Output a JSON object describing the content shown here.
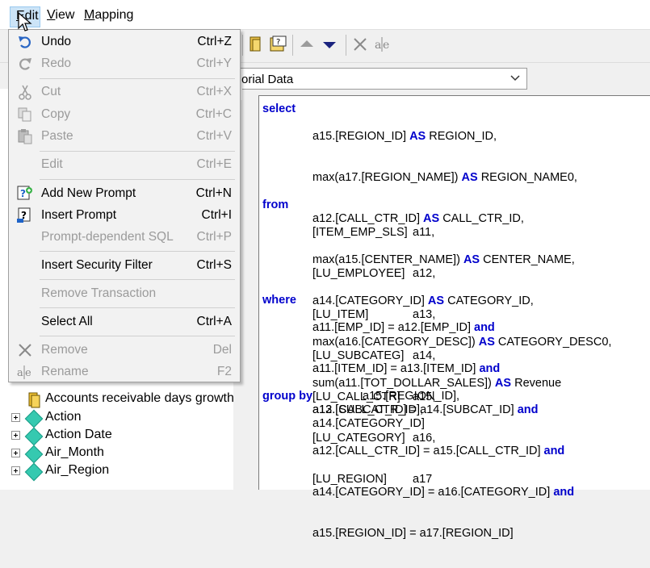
{
  "menubar": {
    "items": [
      {
        "label": "Edit",
        "mnemonic": "E",
        "rest": "dit"
      },
      {
        "label": "View",
        "mnemonic": "V",
        "rest": "iew"
      },
      {
        "label": "Mapping",
        "mnemonic": "M",
        "rest": "apping"
      }
    ]
  },
  "toolbar": {
    "icons": [
      "data-source-icon",
      "prompt-icon",
      "move-up-icon",
      "move-down-icon",
      "delete-icon",
      "rename-icon"
    ]
  },
  "combo": {
    "value": "orial Data"
  },
  "edit_menu": {
    "items": [
      {
        "label": "Undo",
        "shortcut": "Ctrl+Z",
        "icon": "undo-icon",
        "enabled": true
      },
      {
        "label": "Redo",
        "shortcut": "Ctrl+Y",
        "icon": "redo-icon",
        "enabled": false
      },
      {
        "label": "Cut",
        "shortcut": "Ctrl+X",
        "icon": "cut-icon",
        "enabled": false
      },
      {
        "label": "Copy",
        "shortcut": "Ctrl+C",
        "icon": "copy-icon",
        "enabled": false
      },
      {
        "label": "Paste",
        "shortcut": "Ctrl+V",
        "icon": "paste-icon",
        "enabled": false
      },
      {
        "label": "Edit",
        "shortcut": "Ctrl+E",
        "icon": "",
        "enabled": false
      },
      {
        "label": "Add New Prompt",
        "shortcut": "Ctrl+N",
        "icon": "add-prompt-icon",
        "enabled": true
      },
      {
        "label": "Insert Prompt",
        "shortcut": "Ctrl+I",
        "icon": "insert-prompt-icon",
        "enabled": true
      },
      {
        "label": "Prompt-dependent SQL",
        "shortcut": "Ctrl+P",
        "icon": "",
        "enabled": false
      },
      {
        "label": "Insert Security Filter",
        "shortcut": "Ctrl+S",
        "icon": "",
        "enabled": true
      },
      {
        "label": "Remove Transaction",
        "shortcut": "",
        "icon": "",
        "enabled": false
      },
      {
        "label": "Select All",
        "shortcut": "Ctrl+A",
        "icon": "",
        "enabled": true
      },
      {
        "label": "Remove",
        "shortcut": "Del",
        "icon": "remove-icon",
        "enabled": false
      },
      {
        "label": "Rename",
        "shortcut": "F2",
        "icon": "rename-icon",
        "enabled": false
      }
    ]
  },
  "tree": {
    "items": [
      {
        "label": "Accounts receivable days growth",
        "icon": "metric-icon",
        "expandable": false
      },
      {
        "label": "Action",
        "icon": "attribute-icon",
        "expandable": true
      },
      {
        "label": "Action Date",
        "icon": "attribute-icon",
        "expandable": true
      },
      {
        "label": "Air_Month",
        "icon": "attribute-icon",
        "expandable": true
      },
      {
        "label": "Air_Region",
        "icon": "attribute-icon",
        "expandable": true
      }
    ]
  },
  "sql": {
    "select_kw": "select",
    "from_kw": "from",
    "where_kw": "where",
    "groupby_kw": "group by",
    "select_lines": [
      {
        "pre": "a15.[REGION_ID] ",
        "kw": "AS",
        "post": " REGION_ID,"
      },
      {
        "pre": "max(a17.[REGION_NAME]) ",
        "kw": "AS",
        "post": " REGION_NAME0,"
      },
      {
        "pre": "a12.[CALL_CTR_ID] ",
        "kw": "AS",
        "post": " CALL_CTR_ID,"
      },
      {
        "pre": "max(a15.[CENTER_NAME]) ",
        "kw": "AS",
        "post": " CENTER_NAME,"
      },
      {
        "pre": "a14.[CATEGORY_ID] ",
        "kw": "AS",
        "post": " CATEGORY_ID,"
      },
      {
        "pre": "max(a16.[CATEGORY_DESC]) ",
        "kw": "AS",
        "post": " CATEGORY_DESC0,"
      },
      {
        "pre": "sum(a11.[TOT_DOLLAR_SALES]) ",
        "kw": "AS",
        "post": " Revenue"
      }
    ],
    "from_lines": [
      {
        "table": "[ITEM_EMP_SLS]",
        "alias": "a11,"
      },
      {
        "table": "[LU_EMPLOYEE]",
        "alias": "a12,"
      },
      {
        "table": "[LU_ITEM]",
        "alias": "a13,"
      },
      {
        "table": "[LU_SUBCATEG]",
        "alias": "a14,"
      },
      {
        "table": "[LU_CALL_CTR]",
        "alias": "a15,"
      },
      {
        "table": "[LU_CATEGORY]",
        "alias": "a16,"
      },
      {
        "table": "[LU_REGION]",
        "alias": "a17"
      }
    ],
    "where_lines": [
      {
        "pre": "a11.[EMP_ID] = a12.[EMP_ID] ",
        "kw": "and"
      },
      {
        "pre": "a11.[ITEM_ID] = a13.[ITEM_ID] ",
        "kw": "and"
      },
      {
        "pre": "a13.[SUBCAT_ID] = a14.[SUBCAT_ID] ",
        "kw": "and"
      },
      {
        "pre": "a12.[CALL_CTR_ID] = a15.[CALL_CTR_ID] ",
        "kw": "and"
      },
      {
        "pre": "a14.[CATEGORY_ID] = a16.[CATEGORY_ID] ",
        "kw": "and"
      },
      {
        "pre": "a15.[REGION_ID] = a17.[REGION_ID]",
        "kw": ""
      }
    ],
    "groupby_lines": [
      "a15.[REGION_ID],",
      "a12.[CALL_CTR_ID],",
      "a14.[CATEGORY_ID]"
    ]
  }
}
